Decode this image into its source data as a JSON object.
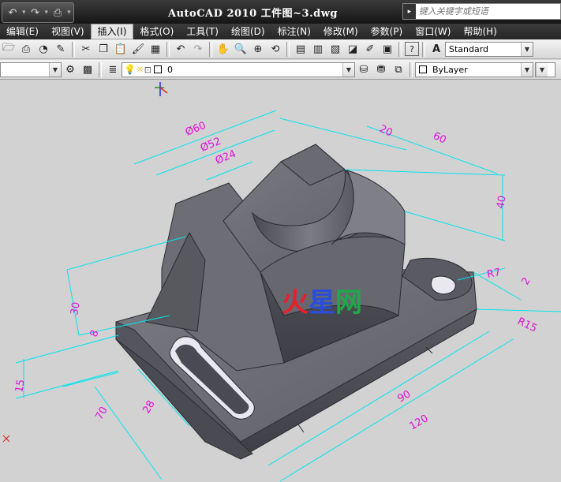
{
  "app": {
    "title": "AutoCAD  2010   工件图~3.dwg"
  },
  "quick_access": {
    "icons": [
      "undo-icon",
      "redo-icon",
      "print-icon",
      "dropdown-icon"
    ]
  },
  "help_search": {
    "placeholder": "键入关键字或短语"
  },
  "menu": {
    "items": [
      {
        "label": "编辑(E)"
      },
      {
        "label": "视图(V)"
      },
      {
        "label": "插入(I)",
        "active": true
      },
      {
        "label": "格式(O)"
      },
      {
        "label": "工具(T)"
      },
      {
        "label": "绘图(D)"
      },
      {
        "label": "标注(N)"
      },
      {
        "label": "修改(M)"
      },
      {
        "label": "参数(P)"
      },
      {
        "label": "窗口(W)"
      },
      {
        "label": "帮助(H)"
      }
    ]
  },
  "toolbar1": {
    "text_style": "Standard"
  },
  "toolbar2": {
    "layer_value": "0",
    "color_value": "ByLayer"
  },
  "drawing": {
    "dimensions": [
      "Ø60",
      "Ø52",
      "Ø24",
      "20",
      "60",
      "40",
      "30",
      "8",
      "15",
      "70",
      "28",
      "90",
      "120",
      "R7",
      "R15",
      "2"
    ],
    "watermark": [
      "火",
      "星",
      "网"
    ],
    "colors": {
      "dimension_line": "#00e5ee",
      "dimension_text": "#e010d8",
      "solid_face_light": "#6e6e76",
      "solid_face_dark": "#4e4e56",
      "viewport_bg": "#d2d2d2"
    }
  }
}
